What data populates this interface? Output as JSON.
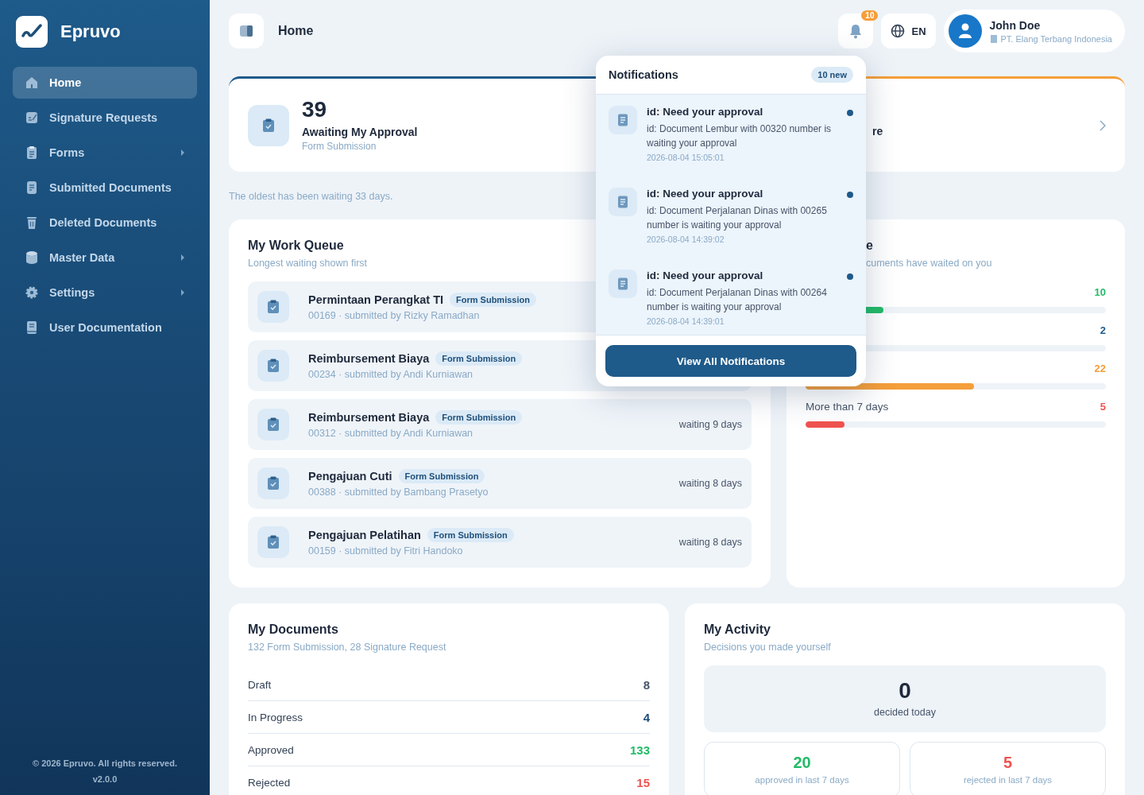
{
  "app": {
    "name": "Epruvo"
  },
  "sidebar": {
    "items": [
      {
        "label": "Home",
        "selected": true,
        "has_submenu": false
      },
      {
        "label": "Signature Requests",
        "selected": false,
        "has_submenu": false
      },
      {
        "label": "Forms",
        "selected": false,
        "has_submenu": true
      },
      {
        "label": "Submitted Documents",
        "selected": false,
        "has_submenu": false
      },
      {
        "label": "Deleted Documents",
        "selected": false,
        "has_submenu": false
      },
      {
        "label": "Master Data",
        "selected": false,
        "has_submenu": true
      },
      {
        "label": "Settings",
        "selected": false,
        "has_submenu": true
      },
      {
        "label": "User Documentation",
        "selected": false,
        "has_submenu": false
      }
    ],
    "copyright": "© 2026 Epruvo. All rights reserved.",
    "version": "v2.0.0"
  },
  "header": {
    "title": "Home",
    "notification_count": "10",
    "language": "EN",
    "user": {
      "name": "John Doe",
      "company": "PT. Elang Terbang Indonesia"
    }
  },
  "summary_cards": [
    {
      "value": "39",
      "label": "Awaiting My Approval",
      "sublabel": "Form Submission",
      "color": "#1e5a8a"
    },
    {
      "label": "re",
      "color": "#f59e3b"
    }
  ],
  "oldest_note": "The oldest has been waiting 33 days.",
  "work_queue": {
    "title": "My Work Queue",
    "subtitle": "Longest waiting shown first",
    "items": [
      {
        "title": "Permintaan Perangkat TI",
        "tag": "Form Submission",
        "meta": "00169 · submitted by Rizky Ramadhan"
      },
      {
        "title": "Reimbursement Biaya",
        "tag": "Form Submission",
        "meta": "00234 · submitted by Andi Kurniawan"
      },
      {
        "title": "Reimbursement Biaya",
        "tag": "Form Submission",
        "meta": "00312 · submitted by Andi Kurniawan",
        "waiting": "waiting 9 days"
      },
      {
        "title": "Pengajuan Cuti",
        "tag": "Form Submission",
        "meta": "00388 · submitted by Bambang Prasetyo",
        "waiting": "waiting 8 days"
      },
      {
        "title": "Pengajuan Pelatihan",
        "tag": "Form Submission",
        "meta": "00159 · submitted by Fitri Handoko",
        "waiting": "waiting 8 days"
      }
    ]
  },
  "aging": {
    "title": "e",
    "subtitle": "cuments have waited on you",
    "rows": [
      {
        "count": "10",
        "level": 0.26,
        "color": "#22bb66"
      },
      {
        "count": "2",
        "color": "#1e5a8a"
      },
      {
        "count": "22",
        "level": 0.56,
        "color": "#f59e3b"
      },
      {
        "label": "More than 7 days",
        "count": "5",
        "level": 0.13,
        "color": "#ef5350"
      }
    ]
  },
  "my_documents": {
    "title": "My Documents",
    "subtitle": "132 Form Submission, 28 Signature Request",
    "rows": [
      {
        "label": "Draft",
        "count": "8",
        "color": "#475569"
      },
      {
        "label": "In Progress",
        "count": "4",
        "color": "#1e4f7a"
      },
      {
        "label": "Approved",
        "count": "133",
        "color": "#22bb66"
      },
      {
        "label": "Rejected",
        "count": "15",
        "color": "#ef5350"
      }
    ]
  },
  "my_activity": {
    "title": "My Activity",
    "subtitle": "Decisions you made yourself",
    "today": {
      "value": "0",
      "label": "decided today"
    },
    "stats": [
      {
        "value": "20",
        "label": "approved in last 7 days",
        "color": "#22bb66"
      },
      {
        "value": "5",
        "label": "rejected in last 7 days",
        "color": "#ef5350"
      }
    ]
  },
  "notifications": {
    "title": "Notifications",
    "badge": "10 new",
    "button": "View All Notifications",
    "items": [
      {
        "title": "id: Need your approval",
        "body": "id: Document Lembur with 00320 number is waiting your approval",
        "time": "2026-08-04 15:05:01",
        "unread": true
      },
      {
        "title": "id: Need your approval",
        "body": "id: Document Perjalanan Dinas with 00265 number is waiting your approval",
        "time": "2026-08-04 14:39:02",
        "unread": true
      },
      {
        "title": "id: Need your approval",
        "body": "id: Document Perjalanan Dinas with 00264 number is waiting your approval",
        "time": "2026-08-04 14:39:01",
        "unread": true
      }
    ]
  }
}
